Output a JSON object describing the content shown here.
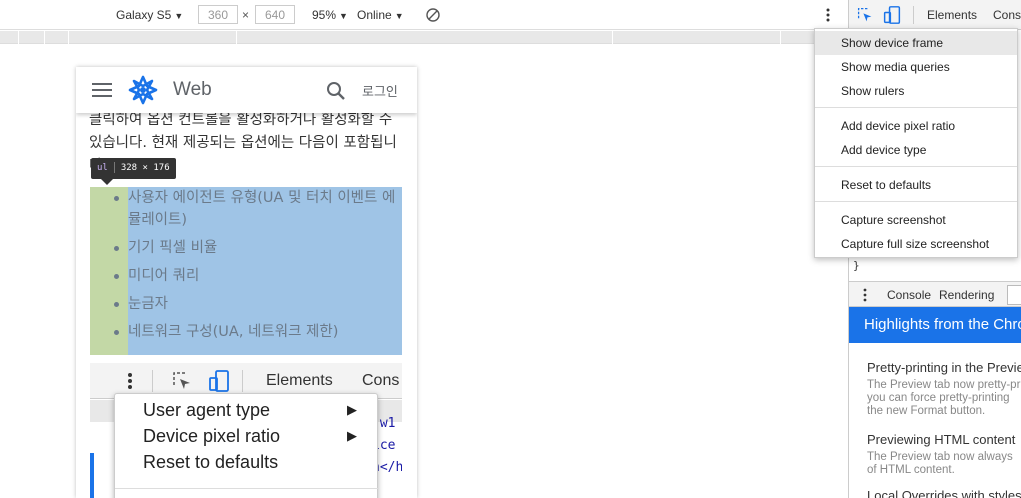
{
  "toolbar": {
    "device": "Galaxy S5",
    "width": "360",
    "times": "×",
    "height": "640",
    "zoom": "95%",
    "network": "Online",
    "caret": "▼"
  },
  "phone": {
    "app_title": "Web",
    "login": "로그인",
    "paragraph": "클릭하여 옵션 컨트롤을 활성화하거나 활성화할 수 있습니다. 현재 제공되는 옵션에는 다음이 포함됩니다.",
    "tooltip": {
      "tag": "ul",
      "size": "328 × 176"
    },
    "list": [
      "사용자 에이전트 유형(UA 및 터치 이벤트 에뮬레이트)",
      "기기 픽셀 비율",
      "미디어 쿼리",
      "눈금자",
      "네트워크 구성(UA, 네트워크 제한)"
    ],
    "nested": {
      "tab_elements": "Elements",
      "tab_console": "Cons",
      "code_lines": [
        "\"w1",
        "ice",
        "n</h"
      ],
      "menu_items": [
        "User agent type",
        "Device pixel ratio",
        "Reset to defaults"
      ],
      "submenu_arrow": "▶"
    }
  },
  "context_menu": {
    "items": [
      "Show device frame",
      "Show media queries",
      "Show rulers",
      "Add device pixel ratio",
      "Add device type",
      "Reset to defaults",
      "Capture screenshot",
      "Capture full size screenshot"
    ]
  },
  "devtools": {
    "tab_elements": "Elements",
    "tab_console": "Conso",
    "code_brace": "}",
    "drawer_tabs": [
      "Console",
      "Rendering"
    ],
    "banner": "Highlights from the Chrome",
    "news": [
      {
        "title": "Pretty-printing in the Preview",
        "body": [
          "The Preview tab now pretty-prints",
          "you can force pretty-printing",
          "the new Format button."
        ]
      },
      {
        "title": "Previewing HTML content",
        "body": [
          "The Preview tab now always",
          "of HTML content."
        ]
      },
      {
        "title": "Local Overrides with styles",
        "body": []
      }
    ]
  },
  "colors": {
    "accent": "#1a73e8",
    "highlight_content": "#9fc4e6",
    "highlight_padding": "#c3d8a6",
    "logo": "#1a73e8"
  }
}
